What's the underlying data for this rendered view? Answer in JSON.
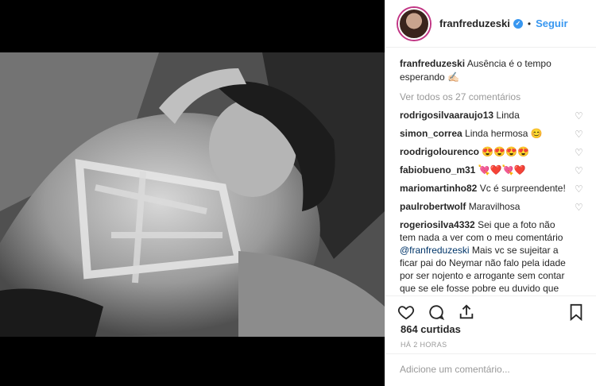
{
  "post": {
    "username": "franfreduzeski",
    "follow_label": "Seguir",
    "dot": "•",
    "caption_text": "Ausência é o tempo esperando",
    "caption_emoji": "✍🏻",
    "view_all": "Ver todos os 27 comentários",
    "likes": "864 curtidas",
    "time": "HÁ 2 HORAS",
    "add_comment_placeholder": "Adicione um comentário..."
  },
  "comments": [
    {
      "user": "rodrigosilvaaraujo13",
      "text": "Linda"
    },
    {
      "user": "simon_correa",
      "text": "Linda hermosa 😊"
    },
    {
      "user": "roodrigolourenco",
      "text": "😍😍😍😍"
    },
    {
      "user": "fabiobueno_m31",
      "text": "💘❤️💘❤️"
    },
    {
      "user": "mariomartinho82",
      "text": "Vc é surpreendente!"
    },
    {
      "user": "paulrobertwolf",
      "text": "Maravilhosa"
    },
    {
      "user": "rogeriosilva4332",
      "text_before": "Sei que a foto não tem nada a ver com o meu comentário",
      "mention": "@franfreduzeski",
      "text_after": "Mais vc se sujeitar a ficar pai do Neymar não falo pela idade por ser nojento e arrogante sem contar que se ele fosse pobre eu duvido que vc teria qualquer tipo de relação não me"
    }
  ],
  "icons": {
    "heart": "♡",
    "verified": "✓"
  },
  "colors": {
    "accent": "#3897f0",
    "muted": "#999999"
  }
}
